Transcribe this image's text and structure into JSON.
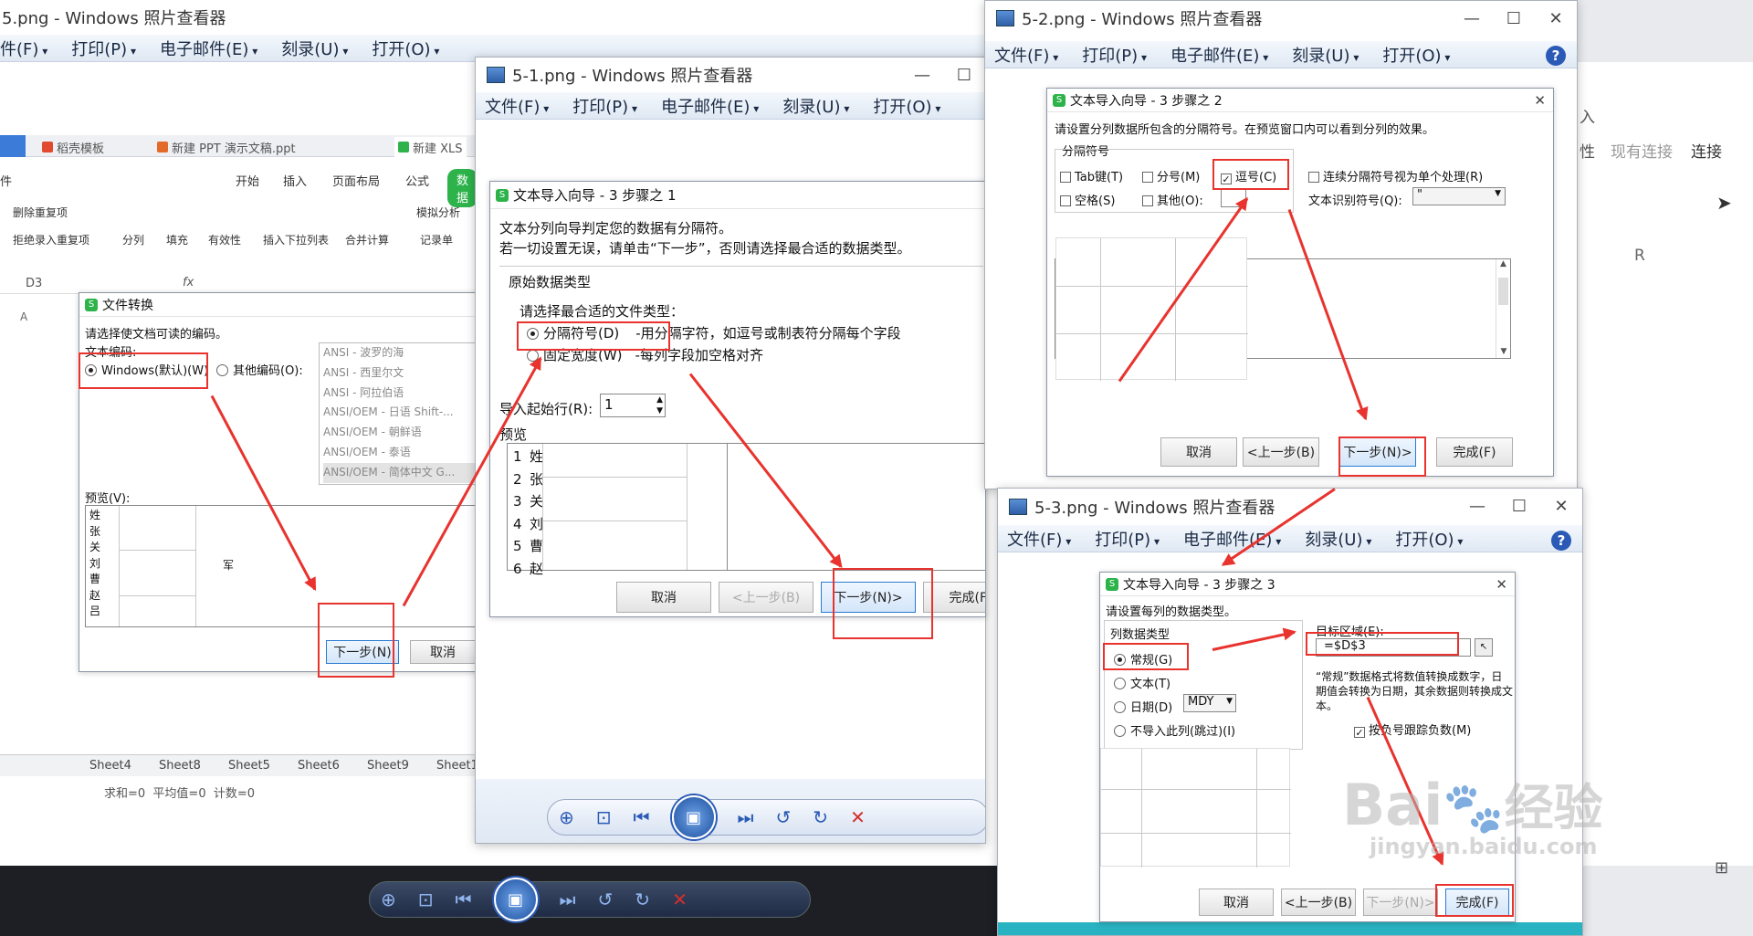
{
  "viewer_back": {
    "title": "5.png - Windows 照片查看器",
    "menu": [
      "件(F)",
      "打印(P)",
      "电子邮件(E)",
      "刻录(U)",
      "打开(O)"
    ]
  },
  "viewer_1": {
    "title": "5-1.png - Windows 照片查看器",
    "menu": [
      "文件(F)",
      "打印(P)",
      "电子邮件(E)",
      "刻录(U)",
      "打开(O)"
    ]
  },
  "viewer_2": {
    "title": "5-2.png - Windows 照片查看器",
    "menu": [
      "文件(F)",
      "打印(P)",
      "电子邮件(E)",
      "刻录(U)",
      "打开(O)"
    ]
  },
  "viewer_3": {
    "title": "5-3.png - Windows 照片查看器",
    "menu": [
      "文件(F)",
      "打印(P)",
      "电子邮件(E)",
      "刻录(U)",
      "打开(O)"
    ]
  },
  "wps": {
    "tabs": [
      "稻壳模板",
      "新建 PPT 演示文稿.ppt",
      "新建 XLS"
    ],
    "ribbon_tabs": [
      "件",
      "开始",
      "插入",
      "页面布局",
      "公式",
      "数据"
    ],
    "tools": [
      "删除重复项",
      "拒绝录入重复项",
      "分列",
      "填充",
      "有效性",
      "插入下拉列表",
      "合并计算",
      "模拟分析",
      "记录单"
    ],
    "cell_ref": "D3",
    "fx": "fx",
    "col_a": "A",
    "col_r": "R",
    "sheets": [
      "Sheet4",
      "Sheet8",
      "Sheet5",
      "Sheet6",
      "Sheet9",
      "Sheet1"
    ],
    "status": "求和=0  平均值=0  计数=0",
    "right_tools": [
      "入",
      "性",
      "现有连接",
      "连接"
    ]
  },
  "file_convert": {
    "title": "文件转换",
    "prompt": "请选择使文档可读的编码。",
    "encoding_label": "文本编码:",
    "option_windows": "Windows(默认)(W)",
    "option_other": "其他编码(O):",
    "encodings": [
      "ANSI - 波罗的海",
      "ANSI - 西里尔文",
      "ANSI - 阿拉伯语",
      "ANSI/OEM - 日语 Shift-...",
      "ANSI/OEM - 朝鲜语",
      "ANSI/OEM - 泰语",
      "ANSI/OEM - 简体中文 G..."
    ],
    "preview_label": "预览(V):",
    "preview_rows": [
      "姓",
      "张",
      "关",
      "刘",
      "曹",
      "赵",
      "吕"
    ],
    "preview_extra": "军",
    "next": "下一步(N)",
    "cancel": "取消"
  },
  "wizard1": {
    "title": "文本导入向导 - 3 步骤之 1",
    "line1": "文本分列向导判定您的数据有分隔符。",
    "line2": "若一切设置无误，请单击“下一步”，否则请选择最合适的数据类型。",
    "group": "原始数据类型",
    "choose": "请选择最合适的文件类型：",
    "opt1": "分隔符号(D)",
    "opt1_desc": "-用分隔字符，如逗号或制表符分隔每个字段",
    "opt2": "固定宽度(W)",
    "opt2_desc": "-每列字段加空格对齐",
    "start_row_label": "导入起始行(R):",
    "start_row": "1",
    "preview_label": "预览",
    "preview_nums": [
      "1",
      "2",
      "3",
      "4",
      "5",
      "6"
    ],
    "preview_chars": [
      "姓",
      "张",
      "关",
      "刘",
      "曹",
      "赵"
    ],
    "cancel": "取消",
    "prev": "<上一步(B)",
    "next": "下一步(N)>",
    "finish": "完成(F)"
  },
  "wizard2": {
    "title": "文本导入向导 - 3 步骤之 2",
    "desc": "请设置分列数据所包含的分隔符号。在预览窗口内可以看到分列的效果。",
    "group": "分隔符号",
    "tab": "Tab键(T)",
    "semicolon": "分号(M)",
    "comma": "逗号(C)",
    "space": "空格(S)",
    "other": "其他(O):",
    "consecutive": "连续分隔符号视为单个处理(R)",
    "qualifier_label": "文本识别符号(Q):",
    "qualifier": "\"",
    "cancel": "取消",
    "prev": "<上一步(B)",
    "next": "下一步(N)>",
    "finish": "完成(F)"
  },
  "wizard3": {
    "title": "文本导入向导 - 3 步骤之 3",
    "desc": "请设置每列的数据类型。",
    "group": "列数据类型",
    "general": "常规(G)",
    "text": "文本(T)",
    "date": "日期(D)",
    "date_fmt": "MDY",
    "skip": "不导入此列(跳过)(I)",
    "target_label": "目标区域(E):",
    "target": "=$D$3",
    "note": "“常规”数据格式将数值转换成数字，日期值会转换为日期，其余数据则转换成文本。",
    "negative": "按负号跟踪负数(M)",
    "cancel": "取消",
    "prev": "<上一步(B)",
    "next": "下一步(N)>",
    "finish": "完成(F)"
  },
  "watermark": {
    "brand": "Bai",
    "brand2": "经验",
    "url": "jingyan.baidu.com"
  },
  "colors": {
    "accent_red": "#e8332e",
    "menu_blue": "#2a5ab6",
    "wps_green": "#2db34a"
  }
}
